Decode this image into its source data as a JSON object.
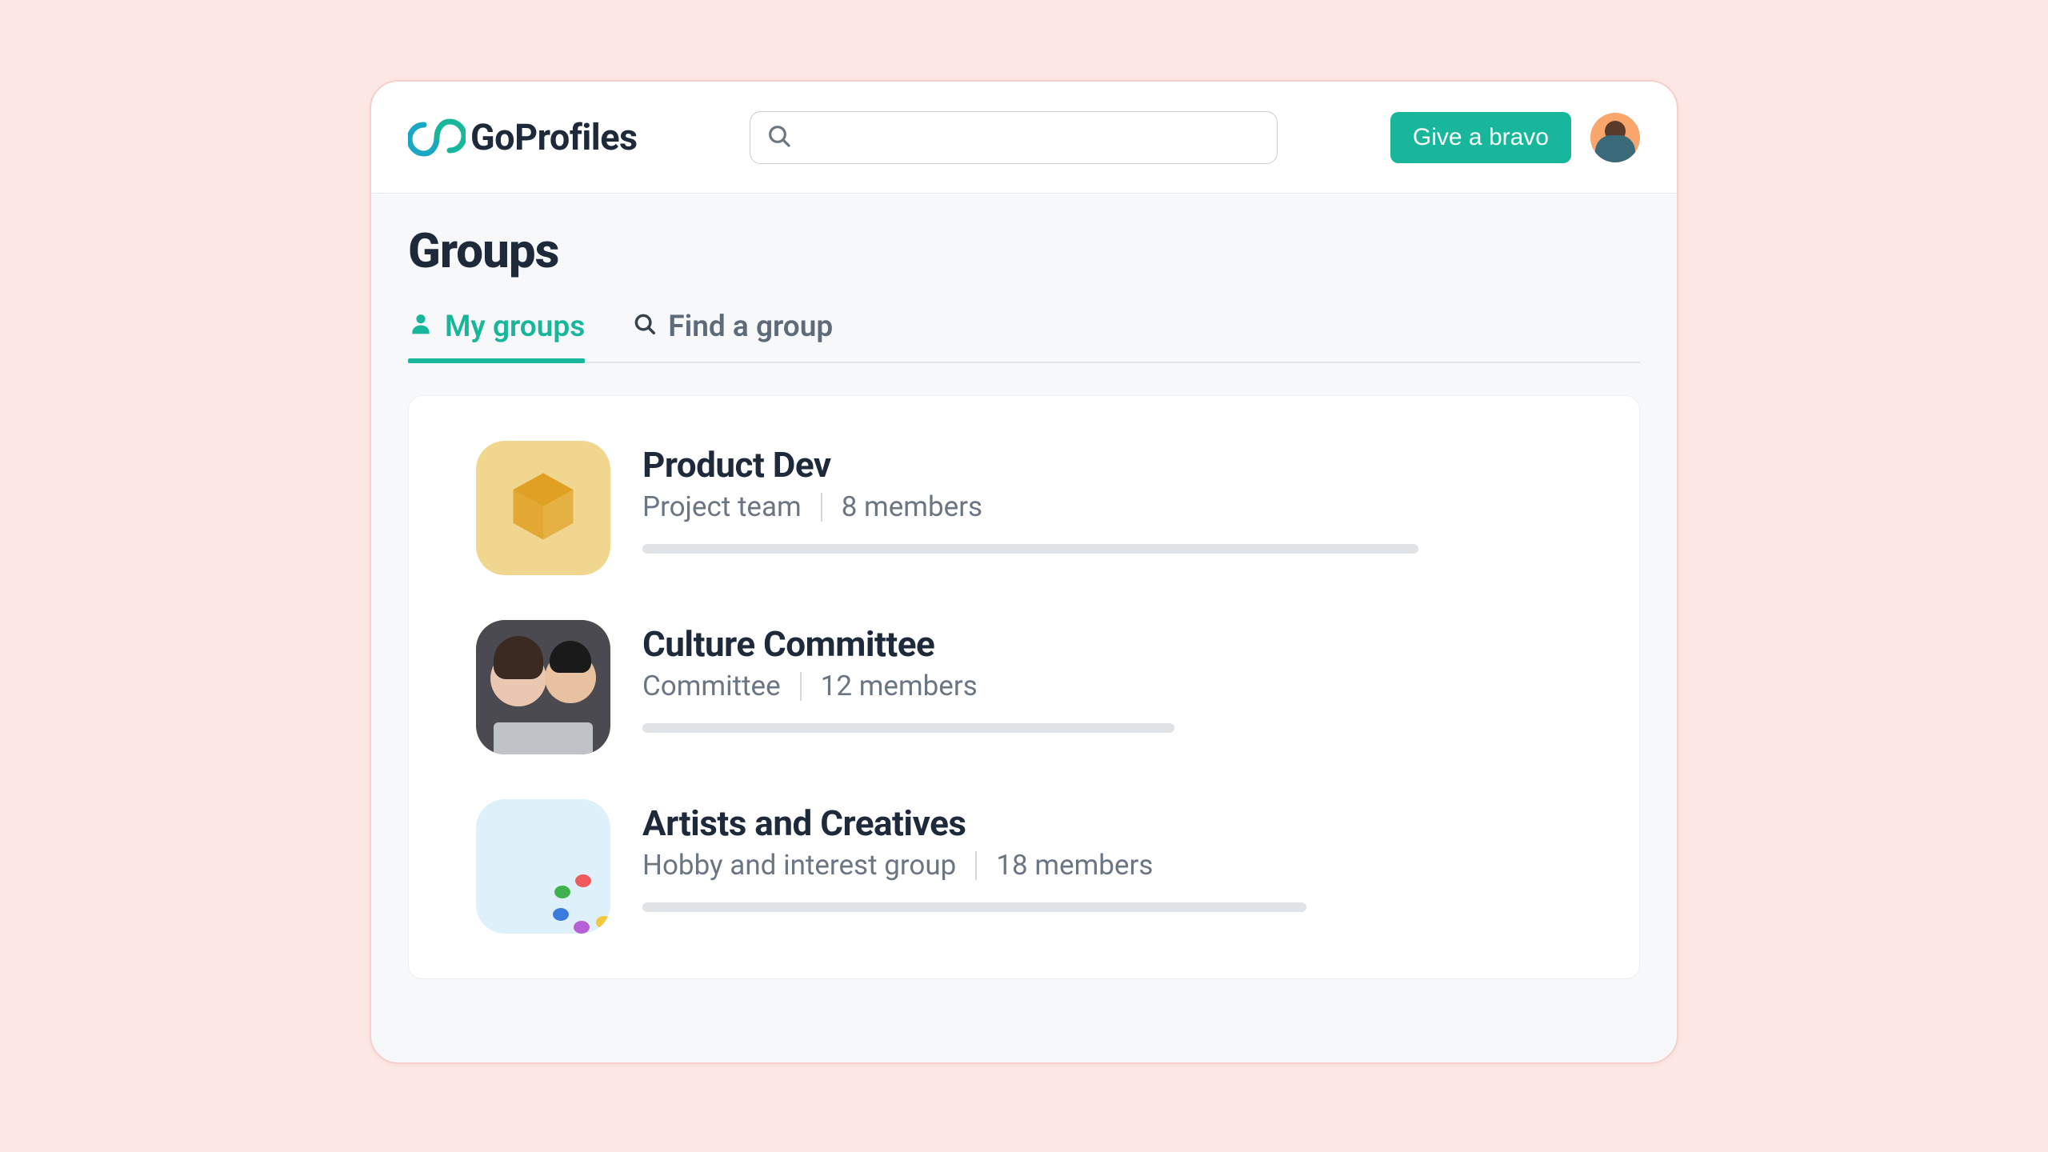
{
  "brand": {
    "name": "GoProfiles"
  },
  "colors": {
    "accent": "#18b79b"
  },
  "header": {
    "search_placeholder": "",
    "bravo_button": "Give a bravo"
  },
  "page": {
    "title": "Groups"
  },
  "tabs": [
    {
      "id": "my-groups",
      "label": "My groups",
      "icon": "person-icon",
      "active": true
    },
    {
      "id": "find-group",
      "label": "Find a group",
      "icon": "search-icon",
      "active": false
    }
  ],
  "groups": [
    {
      "name": "Product Dev",
      "type": "Project team",
      "members": "8 members",
      "thumb": "box-icon"
    },
    {
      "name": "Culture Committee",
      "type": "Committee",
      "members": "12 members",
      "thumb": "people-photo"
    },
    {
      "name": "Artists and Creatives",
      "type": "Hobby and interest group",
      "members": "18 members",
      "thumb": "palette-icon"
    }
  ]
}
